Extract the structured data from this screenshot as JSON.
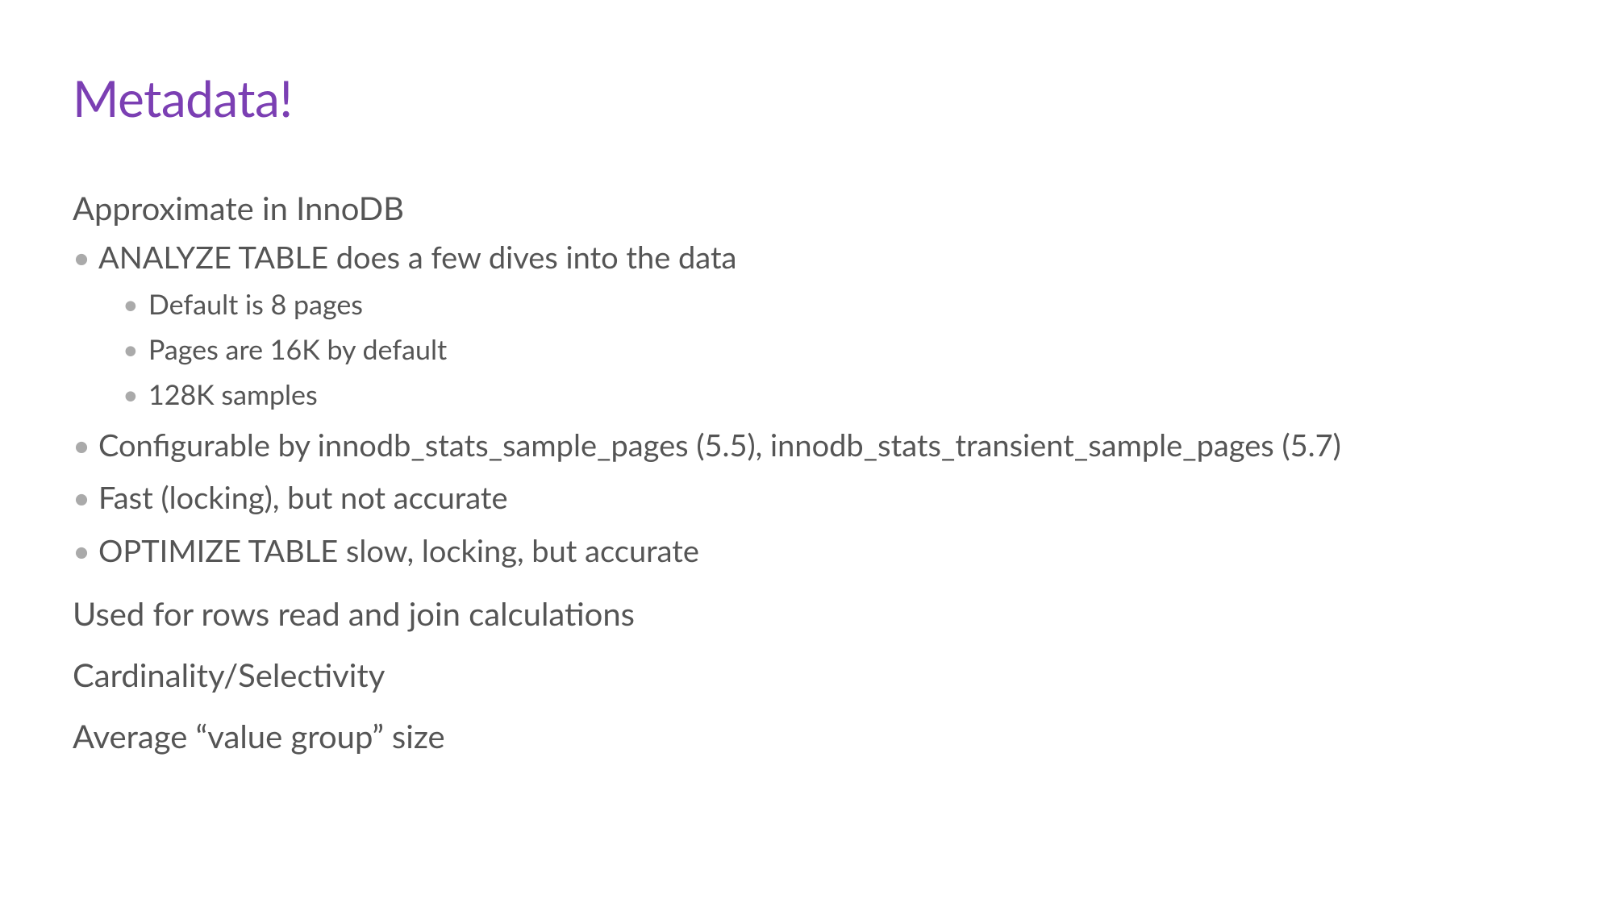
{
  "title": "Metadata!",
  "sections": [
    {
      "heading": "Approximate in InnoDB",
      "bullets": [
        {
          "text": "ANALYZE TABLE does a few dives into the data",
          "sub": [
            "Default is 8 pages",
            "Pages are 16K by default",
            "128K samples"
          ]
        },
        {
          "text": "Configurable by innodb_stats_sample_pages (5.5), innodb_stats_transient_sample_pages (5.7)"
        },
        {
          "text": "Fast (locking), but not accurate"
        },
        {
          "text": "OPTIMIZE TABLE slow, locking, but accurate"
        }
      ]
    },
    {
      "heading": "Used for rows read and join calculations"
    },
    {
      "heading": "Cardinality/Selectivity"
    },
    {
      "heading": "Average “value group” size"
    }
  ]
}
